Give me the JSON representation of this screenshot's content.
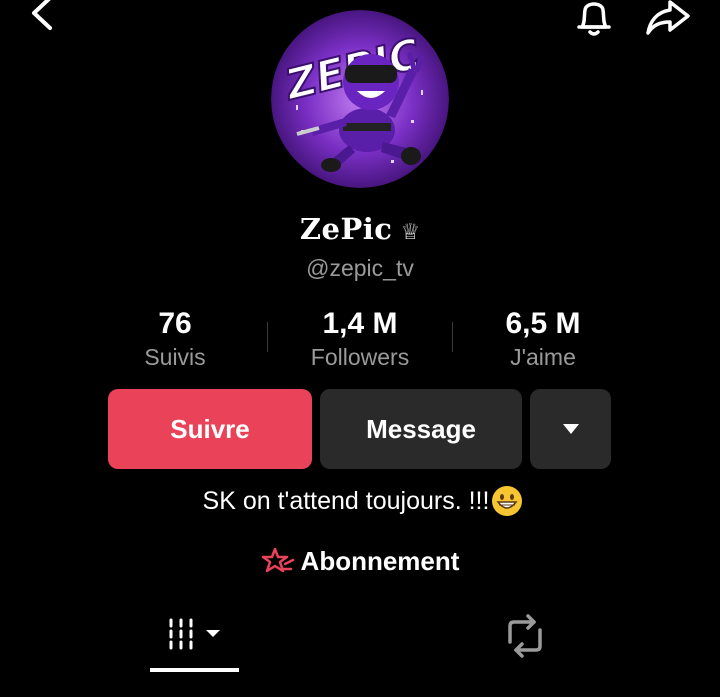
{
  "profile": {
    "display_name": "ZePic",
    "handle": "@zepic_tv",
    "avatar_icon": "ninja-logo",
    "avatar_logo_text": "ZEPIC"
  },
  "stats": [
    {
      "value": "76",
      "label": "Suivis"
    },
    {
      "value": "1,4 M",
      "label": "Followers"
    },
    {
      "value": "6,5 M",
      "label": "J'aime"
    }
  ],
  "actions": {
    "follow_label": "Suivre",
    "message_label": "Message"
  },
  "bio": {
    "text": "SK on t'attend toujours. !!!"
  },
  "subscription": {
    "label": "Abonnement"
  },
  "colors": {
    "background": "#000000",
    "accent": "#ea4359",
    "secondary_button": "#2a2a2a",
    "muted_text": "#9a9a9a"
  },
  "icons": {
    "back": "chevron-left-icon",
    "bell": "bell-icon",
    "share": "share-icon",
    "crown": "crown-icon",
    "dropdown": "caret-down-icon",
    "emoji": "grinning-emoji-icon",
    "subscription": "star-icon",
    "grid": "grid-icon",
    "repost": "repost-icon"
  }
}
